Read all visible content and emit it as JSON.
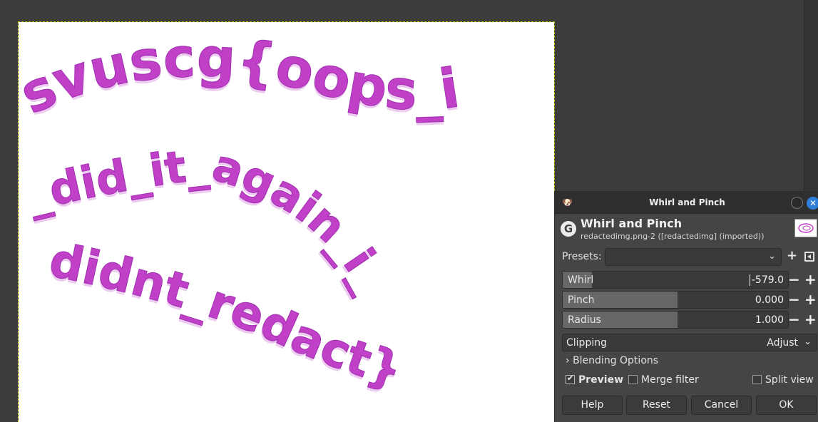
{
  "canvas": {
    "text_line_1": "svuscg{oops_i",
    "text_line_2": "_did_it_again_i_",
    "text_line_3": "didnt_redact}",
    "text_color": "#c040c8"
  },
  "dialog": {
    "window_title": "Whirl and Pinch",
    "app_icon": "gimp-icon",
    "header_title": "Whirl and Pinch",
    "header_subtitle": "redactedimg.png-2 ([redactedimg] (imported))",
    "logo_letter": "G",
    "presets_label": "Presets:",
    "presets_value": "",
    "sliders": [
      {
        "label": "Whirl",
        "value": "-579.0",
        "fill_fraction": 0.13
      },
      {
        "label": "Pinch",
        "value": "0.000",
        "fill_fraction": 0.51
      },
      {
        "label": "Radius",
        "value": "1.000",
        "fill_fraction": 0.51
      }
    ],
    "clipping_label": "Clipping",
    "clipping_value": "Adjust",
    "blending_label": "Blending Options",
    "preview_label": "Preview",
    "preview_checked": true,
    "merge_label": "Merge filter",
    "merge_checked": false,
    "split_label": "Split view",
    "split_checked": false,
    "buttons": {
      "help": "Help",
      "reset": "Reset",
      "cancel": "Cancel",
      "ok": "OK"
    }
  }
}
